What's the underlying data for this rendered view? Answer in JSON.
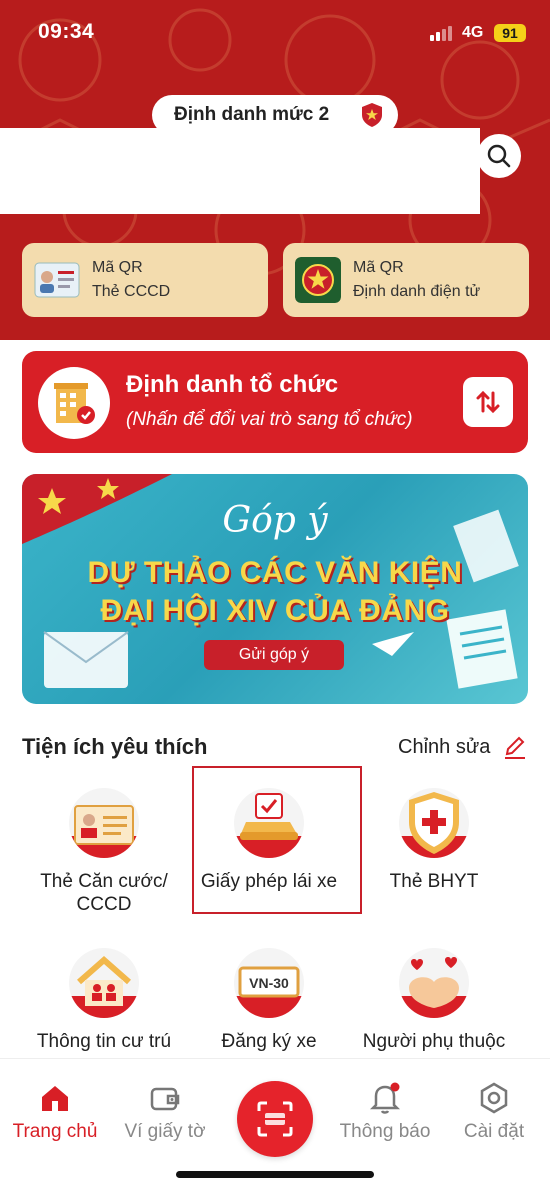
{
  "status": {
    "time": "09:34",
    "network": "4G",
    "battery": "91"
  },
  "header": {
    "level_label": "Định danh mức 2"
  },
  "qr_cards": [
    {
      "line1": "Mã QR",
      "line2": "Thẻ CCCD"
    },
    {
      "line1": "Mã QR",
      "line2": "Định danh điện tử"
    }
  ],
  "org_card": {
    "title": "Định danh tổ chức",
    "subtitle": "(Nhấn để đổi vai trò sang tổ chức)"
  },
  "banner": {
    "heading": "Góp ý",
    "line1": "DỰ THẢO CÁC VĂN KIỆN",
    "line2": "ĐẠI HỘI XIV CỦA ĐẢNG",
    "cta": "Gửi góp ý"
  },
  "favorites": {
    "title": "Tiện ích yêu thích",
    "edit_label": "Chỉnh sửa",
    "items": [
      {
        "label": "Thẻ Căn cước/ CCCD"
      },
      {
        "label": "Giấy phép lái xe"
      },
      {
        "label": "Thẻ BHYT"
      },
      {
        "label": "Thông tin cư trú"
      },
      {
        "label": "Đăng ký xe",
        "plate": "VN-30"
      },
      {
        "label": "Người phụ thuộc"
      }
    ]
  },
  "nav": {
    "items": [
      {
        "label": "Trang chủ"
      },
      {
        "label": "Ví giấy tờ"
      },
      {
        "label": "Thông báo"
      },
      {
        "label": "Cài đặt"
      }
    ]
  },
  "colors": {
    "primary": "#d81f26",
    "header": "#b71c1c",
    "qr_card": "#f3dcae",
    "banner_text": "#f7d84a"
  }
}
